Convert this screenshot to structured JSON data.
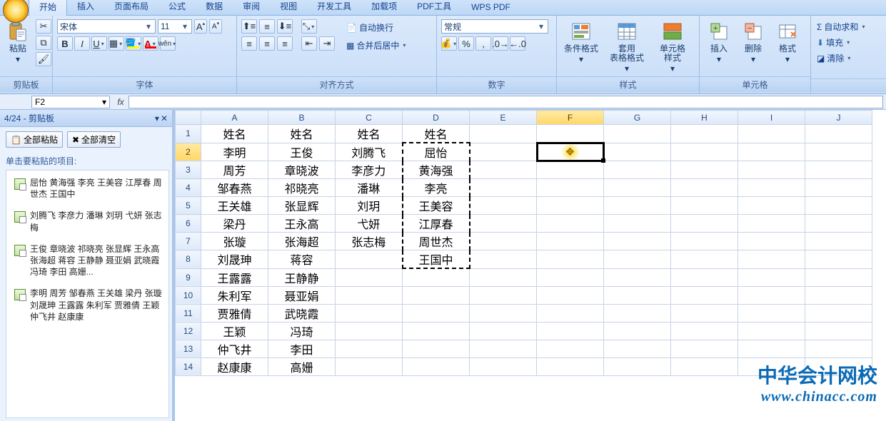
{
  "tabs": {
    "items": [
      "开始",
      "插入",
      "页面布局",
      "公式",
      "数据",
      "审阅",
      "视图",
      "开发工具",
      "加载项",
      "PDF工具",
      "WPS PDF"
    ],
    "active_index": 0
  },
  "ribbon": {
    "clipboard": {
      "label": "剪贴板",
      "paste": "粘贴"
    },
    "font": {
      "label": "字体",
      "family": "宋体",
      "size": "11"
    },
    "align": {
      "label": "对齐方式",
      "wrap": "自动换行",
      "merge": "合并后居中"
    },
    "number": {
      "label": "数字",
      "format": "常规"
    },
    "styles": {
      "label": "样式",
      "cond": "条件格式",
      "tbl": "套用\n表格格式",
      "cell": "单元格\n样式"
    },
    "cells": {
      "label": "单元格",
      "ins": "插入",
      "del": "删除",
      "fmt": "格式"
    },
    "editing": {
      "label": "",
      "sum": "自动求和",
      "fill": "填充",
      "clear": "清除"
    }
  },
  "formula_bar": {
    "name": "F2",
    "fx": "fx",
    "value": ""
  },
  "clipboard_pane": {
    "title": "4/24 - 剪贴板",
    "btn_paste_all": "全部粘贴",
    "btn_clear_all": "全部清空",
    "hint": "单击要粘贴的项目:",
    "items": [
      "屈怡 黄海强 李亮 王美容 江厚春 周世杰 王国中",
      "刘腾飞 李彦力 潘琳 刘玥 弋妍 张志梅",
      "王俊 章晓波 祁晓亮 张显辉 王永高 张海超 蒋容 王静静 聂亚娟 武晓霞 冯琦 李田 高姗...",
      "李明 周芳 邹春燕 王关雄 梁丹 张璇 刘晟珅 王露露 朱利军 贾雅倩 王颖 仲飞井 赵康康"
    ]
  },
  "grid": {
    "columns": [
      "A",
      "B",
      "C",
      "D",
      "E",
      "F",
      "G",
      "H",
      "I",
      "J"
    ],
    "selected_col": "F",
    "selected_row": 2,
    "active_cell": "F2",
    "marquee": {
      "col": "D",
      "r1": 2,
      "r2": 8
    },
    "rows": [
      [
        "姓名",
        "姓名",
        "姓名",
        "姓名",
        "",
        "",
        "",
        "",
        "",
        ""
      ],
      [
        "李明",
        "王俊",
        "刘腾飞",
        "屈怡",
        "",
        "",
        "",
        "",
        "",
        ""
      ],
      [
        "周芳",
        "章晓波",
        "李彦力",
        "黄海强",
        "",
        "",
        "",
        "",
        "",
        ""
      ],
      [
        "邹春燕",
        "祁晓亮",
        "潘琳",
        "李亮",
        "",
        "",
        "",
        "",
        "",
        ""
      ],
      [
        "王关雄",
        "张显辉",
        "刘玥",
        "王美容",
        "",
        "",
        "",
        "",
        "",
        ""
      ],
      [
        "梁丹",
        "王永高",
        "弋妍",
        "江厚春",
        "",
        "",
        "",
        "",
        "",
        ""
      ],
      [
        "张璇",
        "张海超",
        "张志梅",
        "周世杰",
        "",
        "",
        "",
        "",
        "",
        ""
      ],
      [
        "刘晟珅",
        "蒋容",
        "",
        "王国中",
        "",
        "",
        "",
        "",
        "",
        ""
      ],
      [
        "王露露",
        "王静静",
        "",
        "",
        "",
        "",
        "",
        "",
        "",
        ""
      ],
      [
        "朱利军",
        "聂亚娟",
        "",
        "",
        "",
        "",
        "",
        "",
        "",
        ""
      ],
      [
        "贾雅倩",
        "武晓霞",
        "",
        "",
        "",
        "",
        "",
        "",
        "",
        ""
      ],
      [
        "王颖",
        "冯琦",
        "",
        "",
        "",
        "",
        "",
        "",
        "",
        ""
      ],
      [
        "仲飞井",
        "李田",
        "",
        "",
        "",
        "",
        "",
        "",
        "",
        ""
      ],
      [
        "赵康康",
        "高姗",
        "",
        "",
        "",
        "",
        "",
        "",
        "",
        ""
      ]
    ]
  },
  "watermark": {
    "line1": "中华会计网校",
    "line2": "www.chinacc.com"
  }
}
